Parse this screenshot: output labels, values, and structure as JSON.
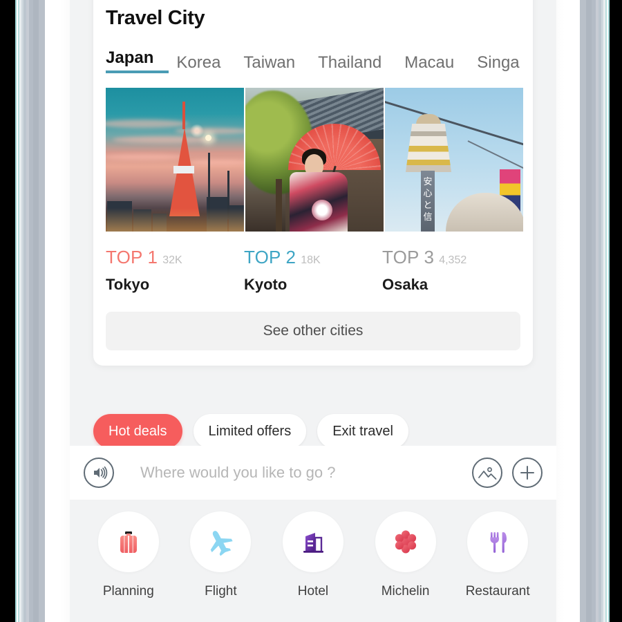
{
  "card": {
    "title": "Travel City",
    "tabs": [
      {
        "label": "Japan",
        "active": true
      },
      {
        "label": "Korea",
        "active": false
      },
      {
        "label": "Taiwan",
        "active": false
      },
      {
        "label": "Thailand",
        "active": false
      },
      {
        "label": "Macau",
        "active": false
      },
      {
        "label": "Singa",
        "active": false
      }
    ],
    "rankings": [
      {
        "rank_label": "TOP 1",
        "count": "32K",
        "city": "Tokyo",
        "photo": "tokyo-tower-dusk",
        "color": "#f4776f"
      },
      {
        "rank_label": "TOP 2",
        "count": "18K",
        "city": "Kyoto",
        "photo": "kimono-woman-red-parasol",
        "color": "#3ea5c4"
      },
      {
        "rank_label": "TOP 3",
        "count": "4,352",
        "city": "Osaka",
        "photo": "tsutenkaku-tower",
        "color": "#9b9b9b"
      }
    ],
    "see_other_label": "See other cities"
  },
  "chips": [
    {
      "label": "Hot deals",
      "selected": true
    },
    {
      "label": "Limited offers",
      "selected": false
    },
    {
      "label": "Exit travel",
      "selected": false
    }
  ],
  "search": {
    "placeholder": "Where would you like to go ?",
    "value": "",
    "voice_icon": "voice-wave-icon",
    "image_icon": "image-icon",
    "add_icon": "plus-icon"
  },
  "shortcuts": [
    {
      "label": "Planning",
      "icon": "suitcase-icon",
      "color": "#f4726f"
    },
    {
      "label": "Flight",
      "icon": "airplane-icon",
      "color": "#7fd4f0"
    },
    {
      "label": "Hotel",
      "icon": "building-icon",
      "color": "#6b2fa0"
    },
    {
      "label": "Michelin",
      "icon": "michelin-flower-icon",
      "color": "#e8505f"
    },
    {
      "label": "Restaurant",
      "icon": "fork-knife-icon",
      "color": "#a87ce0"
    }
  ],
  "theme": {
    "accent_red": "#f65d5d",
    "accent_teal": "#4a9cb5",
    "page_bg": "#f2f3f4",
    "card_bg": "#ffffff"
  }
}
